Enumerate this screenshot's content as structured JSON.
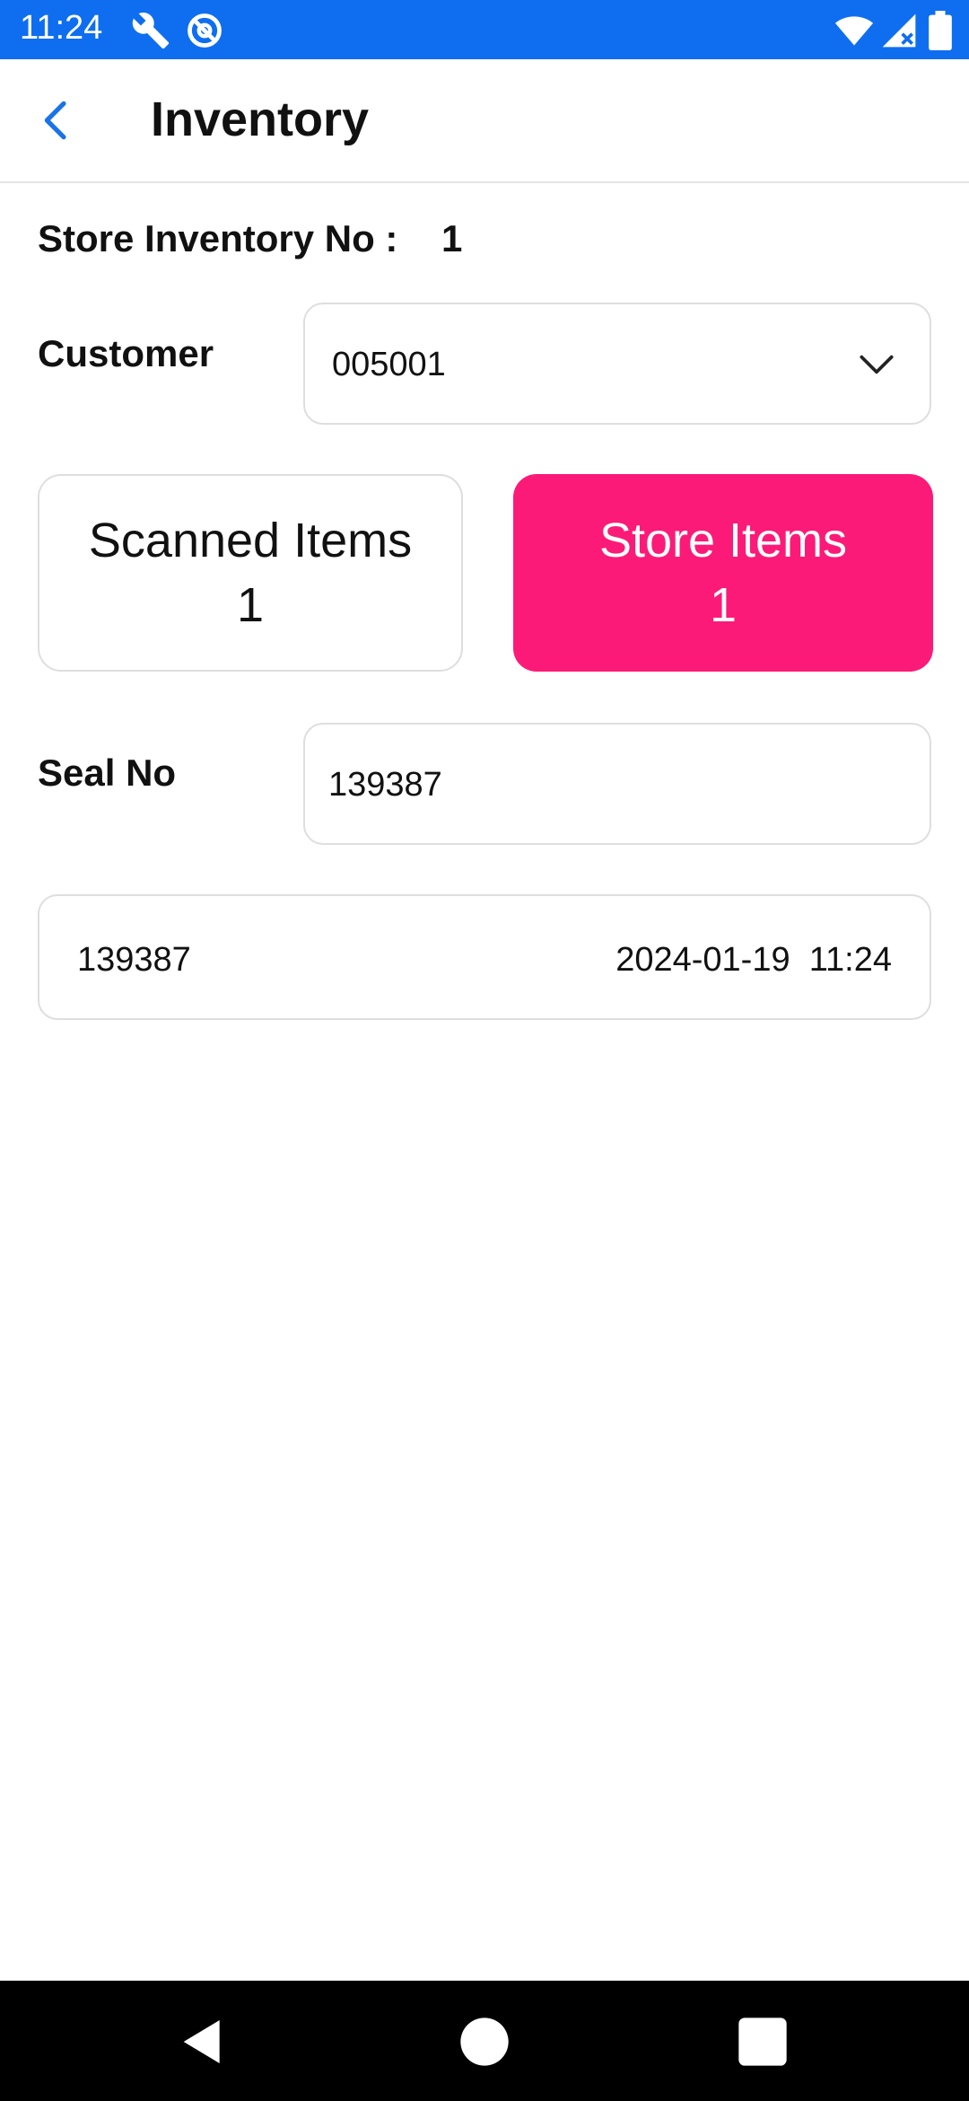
{
  "status_bar": {
    "time": "11:24",
    "icons": [
      "wrench-icon",
      "do-not-disturb-icon",
      "wifi-icon",
      "signal-icon",
      "battery-icon"
    ],
    "color": "#0f6ef0"
  },
  "app_bar": {
    "title": "Inventory",
    "back_icon": "chevron-left-icon",
    "accent": "#1a73e8"
  },
  "inventory": {
    "label": "Store Inventory No :",
    "value": "1"
  },
  "customer": {
    "label": "Customer",
    "selected_value": "005001",
    "icon": "chevron-down-icon"
  },
  "cards": {
    "scanned": {
      "title": "Scanned Items",
      "count": "1"
    },
    "store": {
      "title": "Store Items",
      "count": "1",
      "color": "#fc1a78"
    }
  },
  "seal": {
    "label": "Seal No",
    "value": "139387"
  },
  "items": [
    {
      "seal": "139387",
      "datetime": "2024-01-19  11:24"
    }
  ],
  "nav_bar": {
    "icons": [
      "back-triangle-icon",
      "home-circle-icon",
      "recents-square-icon"
    ]
  }
}
